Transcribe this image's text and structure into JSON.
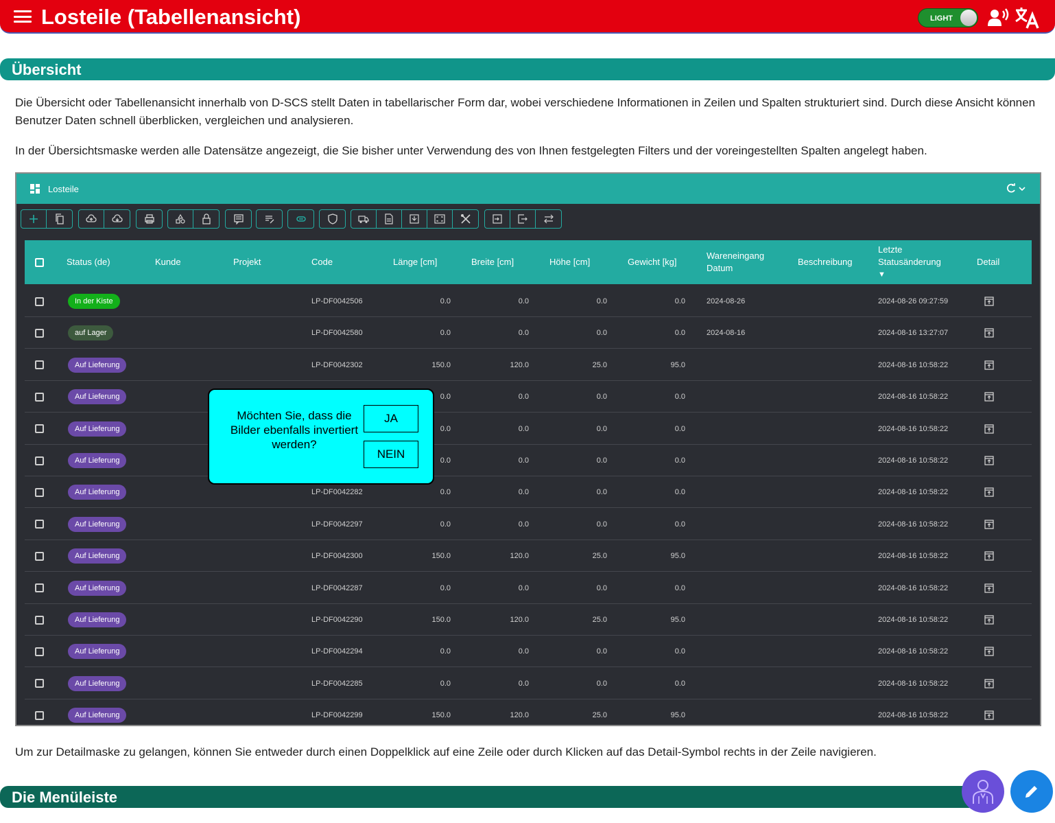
{
  "header": {
    "title": "Losteile (Tabellenansicht)",
    "theme_label": "LIGHT",
    "icons": [
      "menu-icon",
      "speaker-icon",
      "translate-icon"
    ]
  },
  "overview": {
    "heading": "Übersicht",
    "para1": "Die Übersicht oder Tabellenansicht innerhalb von D-SCS stellt Daten in tabellarischer Form dar, wobei verschiedene Informationen in Zeilen und Spalten strukturiert sind. Durch diese Ansicht können Benutzer Daten schnell überblicken, vergleichen und analysieren.",
    "para2": "In der Übersichtsmaske werden alle Datensätze angezeigt, die Sie bisher unter Verwendung des von Ihnen festgelegten Filters und der voreingestellten Spalten angelegt haben.",
    "para3": "Um zur Detailmaske zu gelangen, können Sie entweder durch einen Doppelklick auf eine Zeile oder durch Klicken auf das Detail-Symbol rechts in der Zeile navigieren."
  },
  "menubar_section": {
    "heading": "Die Menüleiste"
  },
  "grid": {
    "title": "Losteile",
    "columns": {
      "status": "Status (de)",
      "kunde": "Kunde",
      "projekt": "Projekt",
      "code": "Code",
      "laenge": "Länge [cm]",
      "breite": "Breite [cm]",
      "hoehe": "Höhe [cm]",
      "gewicht": "Gewicht [kg]",
      "wareneingang_1": "Wareneingang",
      "wareneingang_2": "Datum",
      "beschreibung": "Beschreibung",
      "letzte_1": "Letzte",
      "letzte_2": "Statusänderung",
      "sort_arrow": "▼",
      "detail": "Detail"
    },
    "rows": [
      {
        "status": "In der Kiste",
        "status_color": "#13b01a",
        "code": "LP-DF0042506",
        "laenge": "0.0",
        "breite": "0.0",
        "hoehe": "0.0",
        "gewicht": "0.0",
        "wareneingang": "2024-08-26",
        "letzte": "2024-08-26 09:27:59"
      },
      {
        "status": "auf Lager",
        "status_color": "#3d5a3e",
        "code": "LP-DF0042580",
        "laenge": "0.0",
        "breite": "0.0",
        "hoehe": "0.0",
        "gewicht": "0.0",
        "wareneingang": "2024-08-16",
        "letzte": "2024-08-16 13:27:07"
      },
      {
        "status": "Auf Lieferung",
        "status_color": "#6b4aa8",
        "code": "LP-DF0042302",
        "laenge": "150.0",
        "breite": "120.0",
        "hoehe": "25.0",
        "gewicht": "95.0",
        "wareneingang": "",
        "letzte": "2024-08-16 10:58:22"
      },
      {
        "status": "Auf Lieferung",
        "status_color": "#6b4aa8",
        "code": "",
        "laenge": "0.0",
        "breite": "0.0",
        "hoehe": "0.0",
        "gewicht": "0.0",
        "wareneingang": "",
        "letzte": "2024-08-16 10:58:22"
      },
      {
        "status": "Auf Lieferung",
        "status_color": "#6b4aa8",
        "code": "",
        "laenge": "0.0",
        "breite": "0.0",
        "hoehe": "0.0",
        "gewicht": "0.0",
        "wareneingang": "",
        "letzte": "2024-08-16 10:58:22"
      },
      {
        "status": "Auf Lieferung",
        "status_color": "#6b4aa8",
        "code": "",
        "laenge": "0.0",
        "breite": "0.0",
        "hoehe": "0.0",
        "gewicht": "0.0",
        "wareneingang": "",
        "letzte": "2024-08-16 10:58:22"
      },
      {
        "status": "Auf Lieferung",
        "status_color": "#6b4aa8",
        "code": "LP-DF0042282",
        "laenge": "0.0",
        "breite": "0.0",
        "hoehe": "0.0",
        "gewicht": "0.0",
        "wareneingang": "",
        "letzte": "2024-08-16 10:58:22"
      },
      {
        "status": "Auf Lieferung",
        "status_color": "#6b4aa8",
        "code": "LP-DF0042297",
        "laenge": "0.0",
        "breite": "0.0",
        "hoehe": "0.0",
        "gewicht": "0.0",
        "wareneingang": "",
        "letzte": "2024-08-16 10:58:22"
      },
      {
        "status": "Auf Lieferung",
        "status_color": "#6b4aa8",
        "code": "LP-DF0042300",
        "laenge": "150.0",
        "breite": "120.0",
        "hoehe": "25.0",
        "gewicht": "95.0",
        "wareneingang": "",
        "letzte": "2024-08-16 10:58:22"
      },
      {
        "status": "Auf Lieferung",
        "status_color": "#6b4aa8",
        "code": "LP-DF0042287",
        "laenge": "0.0",
        "breite": "0.0",
        "hoehe": "0.0",
        "gewicht": "0.0",
        "wareneingang": "",
        "letzte": "2024-08-16 10:58:22"
      },
      {
        "status": "Auf Lieferung",
        "status_color": "#6b4aa8",
        "code": "LP-DF0042290",
        "laenge": "150.0",
        "breite": "120.0",
        "hoehe": "25.0",
        "gewicht": "95.0",
        "wareneingang": "",
        "letzte": "2024-08-16 10:58:22"
      },
      {
        "status": "Auf Lieferung",
        "status_color": "#6b4aa8",
        "code": "LP-DF0042294",
        "laenge": "0.0",
        "breite": "0.0",
        "hoehe": "0.0",
        "gewicht": "0.0",
        "wareneingang": "",
        "letzte": "2024-08-16 10:58:22"
      },
      {
        "status": "Auf Lieferung",
        "status_color": "#6b4aa8",
        "code": "LP-DF0042285",
        "laenge": "0.0",
        "breite": "0.0",
        "hoehe": "0.0",
        "gewicht": "0.0",
        "wareneingang": "",
        "letzte": "2024-08-16 10:58:22"
      },
      {
        "status": "Auf Lieferung",
        "status_color": "#6b4aa8",
        "code": "LP-DF0042299",
        "laenge": "150.0",
        "breite": "120.0",
        "hoehe": "25.0",
        "gewicht": "95.0",
        "wareneingang": "",
        "letzte": "2024-08-16 10:58:22"
      }
    ]
  },
  "dialog": {
    "message": "Möchten Sie, dass die Bilder ebenfalls invertiert werden?",
    "yes_label": "JA",
    "no_label": "NEIN"
  },
  "colors": {
    "header_red": "#e3000f",
    "section_teal": "#10958a",
    "grid_teal": "#23aba1",
    "grid_bg": "#2b2d33",
    "dialog_cyan": "#00ffff"
  }
}
